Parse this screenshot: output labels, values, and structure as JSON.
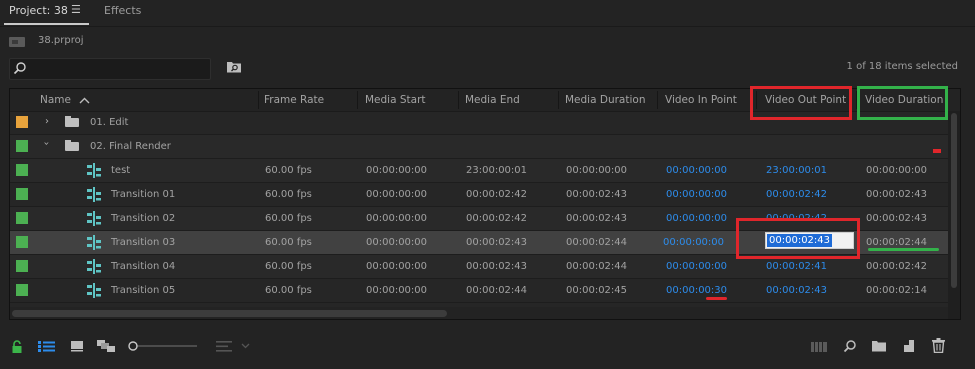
{
  "tabs": {
    "project": "Project: 38",
    "menu_icon": "☰",
    "effects": "Effects"
  },
  "project_file": "38.prproj",
  "search": {
    "placeholder": "",
    "value": ""
  },
  "items_selected": "1 of 18 items selected",
  "columns": {
    "name": "Name",
    "frame_rate": "Frame Rate",
    "media_start": "Media Start",
    "media_end": "Media End",
    "media_duration": "Media Duration",
    "video_in_point": "Video In Point",
    "video_out_point": "Video Out Point",
    "video_duration": "Video Duration"
  },
  "folders": [
    {
      "name": "01. Edit",
      "color": "#e8a33c",
      "expanded": false
    },
    {
      "name": "02. Final Render",
      "color": "#4cb052",
      "expanded": true
    }
  ],
  "rows": [
    {
      "name": "test",
      "frame_rate": "60.00 fps",
      "media_start": "00:00:00:00",
      "media_end": "23:00:00:01",
      "media_duration": "00:00:00:00",
      "video_in_point": "00:00:00:00",
      "video_out_point": "23:00:00:01",
      "video_duration": "00:00:00:00",
      "color": "#4cb052"
    },
    {
      "name": "Transition 01",
      "frame_rate": "60.00 fps",
      "media_start": "00:00:00:00",
      "media_end": "00:00:02:42",
      "media_duration": "00:00:02:43",
      "video_in_point": "00:00:00:00",
      "video_out_point": "00:00:02:42",
      "video_duration": "00:00:02:43",
      "color": "#4cb052"
    },
    {
      "name": "Transition 02",
      "frame_rate": "60.00 fps",
      "media_start": "00:00:00:00",
      "media_end": "00:00:02:42",
      "media_duration": "00:00:02:43",
      "video_in_point": "00:00:00:00",
      "video_out_point": "00:00:02:42",
      "video_duration": "00:00:02:43",
      "color": "#4cb052"
    },
    {
      "name": "Transition 03",
      "frame_rate": "60.00 fps",
      "media_start": "00:00:00:00",
      "media_end": "00:00:02:43",
      "media_duration": "00:00:02:44",
      "video_in_point": "00:00:00:00",
      "video_out_point": "00:00:02:43",
      "video_duration": "00:00:02:44",
      "color": "#4cb052"
    },
    {
      "name": "Transition 04",
      "frame_rate": "60.00 fps",
      "media_start": "00:00:00:00",
      "media_end": "00:00:02:43",
      "media_duration": "00:00:02:44",
      "video_in_point": "00:00:00:00",
      "video_out_point": "00:00:02:41",
      "video_duration": "00:00:02:42",
      "color": "#4cb052"
    },
    {
      "name": "Transition 05",
      "frame_rate": "60.00 fps",
      "media_start": "00:00:00:00",
      "media_end": "00:00:02:44",
      "media_duration": "00:00:02:45",
      "video_in_point": "00:00:00:30",
      "video_out_point": "00:00:02:43",
      "video_duration": "00:00:02:14",
      "color": "#4cb052"
    }
  ],
  "editing_value": "00:00:02:43",
  "annotation_colors": {
    "red": "#e0262b",
    "green": "#33b24a"
  },
  "icons": {
    "lock": "lock-icon",
    "list_view": "list-view-icon",
    "icon_view": "icon-view-icon",
    "freeform_view": "freeform-view-icon",
    "zoom_slider": "zoom-slider",
    "sort": "sort-icons-icon",
    "automate": "automate-to-sequence-icon",
    "find": "find-icon",
    "new_bin": "new-bin-icon",
    "new_item": "new-item-icon",
    "clear": "trash-icon"
  }
}
